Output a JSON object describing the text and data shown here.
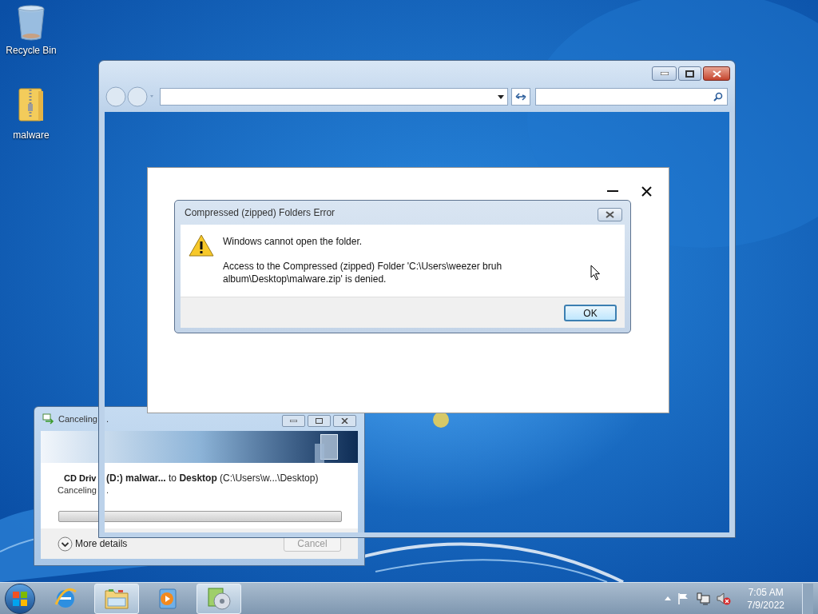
{
  "desktop_icons": [
    {
      "label": "Recycle Bin",
      "kind": "recycle-bin"
    },
    {
      "label": "malware",
      "kind": "zip-folder"
    }
  ],
  "copy_dialog": {
    "title": "Canceling",
    "title_rest": ".",
    "source": "CD Driv",
    "destination": "**(D:) malwar...** to **Desktop** (C:\\Users\\w...\\Desktop)",
    "status": "Canceling",
    "status_rest": ".",
    "progress": {
      "level": 0
    },
    "more_details": "More details",
    "cancel_button": {
      "label": "Cancel",
      "disabled": true
    }
  },
  "error_dialog": {
    "title": "Compressed (zipped) Folders Error",
    "heading": "Windows cannot open the folder.",
    "message": "Access to the Compressed (zipped) Folder 'C:\\Users\\weezer bruh album\\Desktop\\malware.zip' is denied.",
    "ok_button": {
      "label": "OK",
      "focused": true
    }
  },
  "taskbar": {
    "items": [
      {
        "kind": "browser",
        "running": false
      },
      {
        "kind": "folder",
        "running": true
      },
      {
        "kind": "media",
        "running": false
      },
      {
        "kind": "disc",
        "running": true
      }
    ],
    "time": "7:05 AM",
    "date": "7/9/2022"
  }
}
